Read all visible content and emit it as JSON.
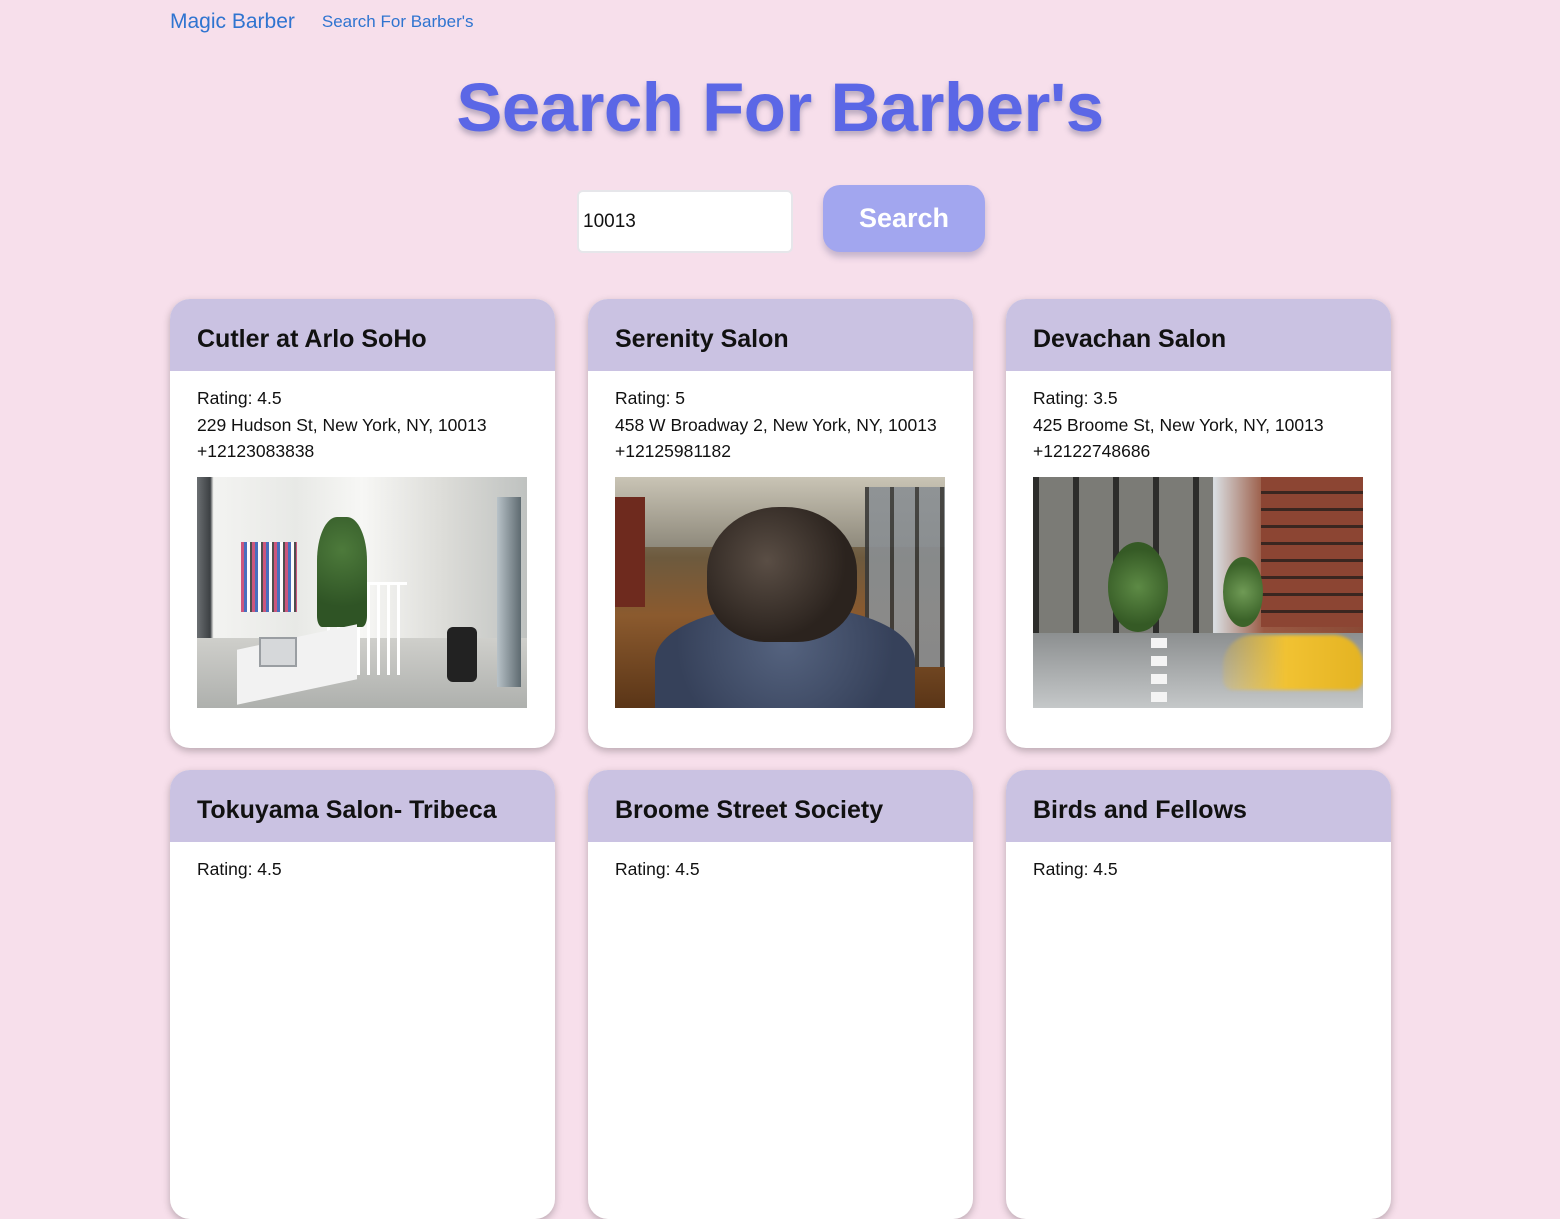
{
  "nav": {
    "brand": "Magic Barber",
    "link": "Search For Barber's"
  },
  "page": {
    "title": "Search For Barber's"
  },
  "search": {
    "value": "10013",
    "button_label": "Search"
  },
  "colors": {
    "background": "#f7dfeb",
    "title": "#5b67e6",
    "button": "#a2a6ef",
    "card_header": "#cac2e2",
    "link": "#2f74d0"
  },
  "results": [
    {
      "name": "Cutler at Arlo SoHo",
      "rating": "Rating: 4.5",
      "address": "229 Hudson St, New York, NY, 10013",
      "phone": "+12123083838"
    },
    {
      "name": "Serenity Salon",
      "rating": "Rating: 5",
      "address": "458 W Broadway 2, New York, NY, 10013",
      "phone": "+12125981182"
    },
    {
      "name": "Devachan Salon",
      "rating": "Rating: 3.5",
      "address": "425 Broome St, New York, NY, 10013",
      "phone": "+12122748686"
    },
    {
      "name": "Tokuyama Salon- Tribeca",
      "rating": "Rating: 4.5"
    },
    {
      "name": "Broome Street Society",
      "rating": "Rating: 4.5"
    },
    {
      "name": "Birds and Fellows",
      "rating": "Rating: 4.5"
    }
  ]
}
